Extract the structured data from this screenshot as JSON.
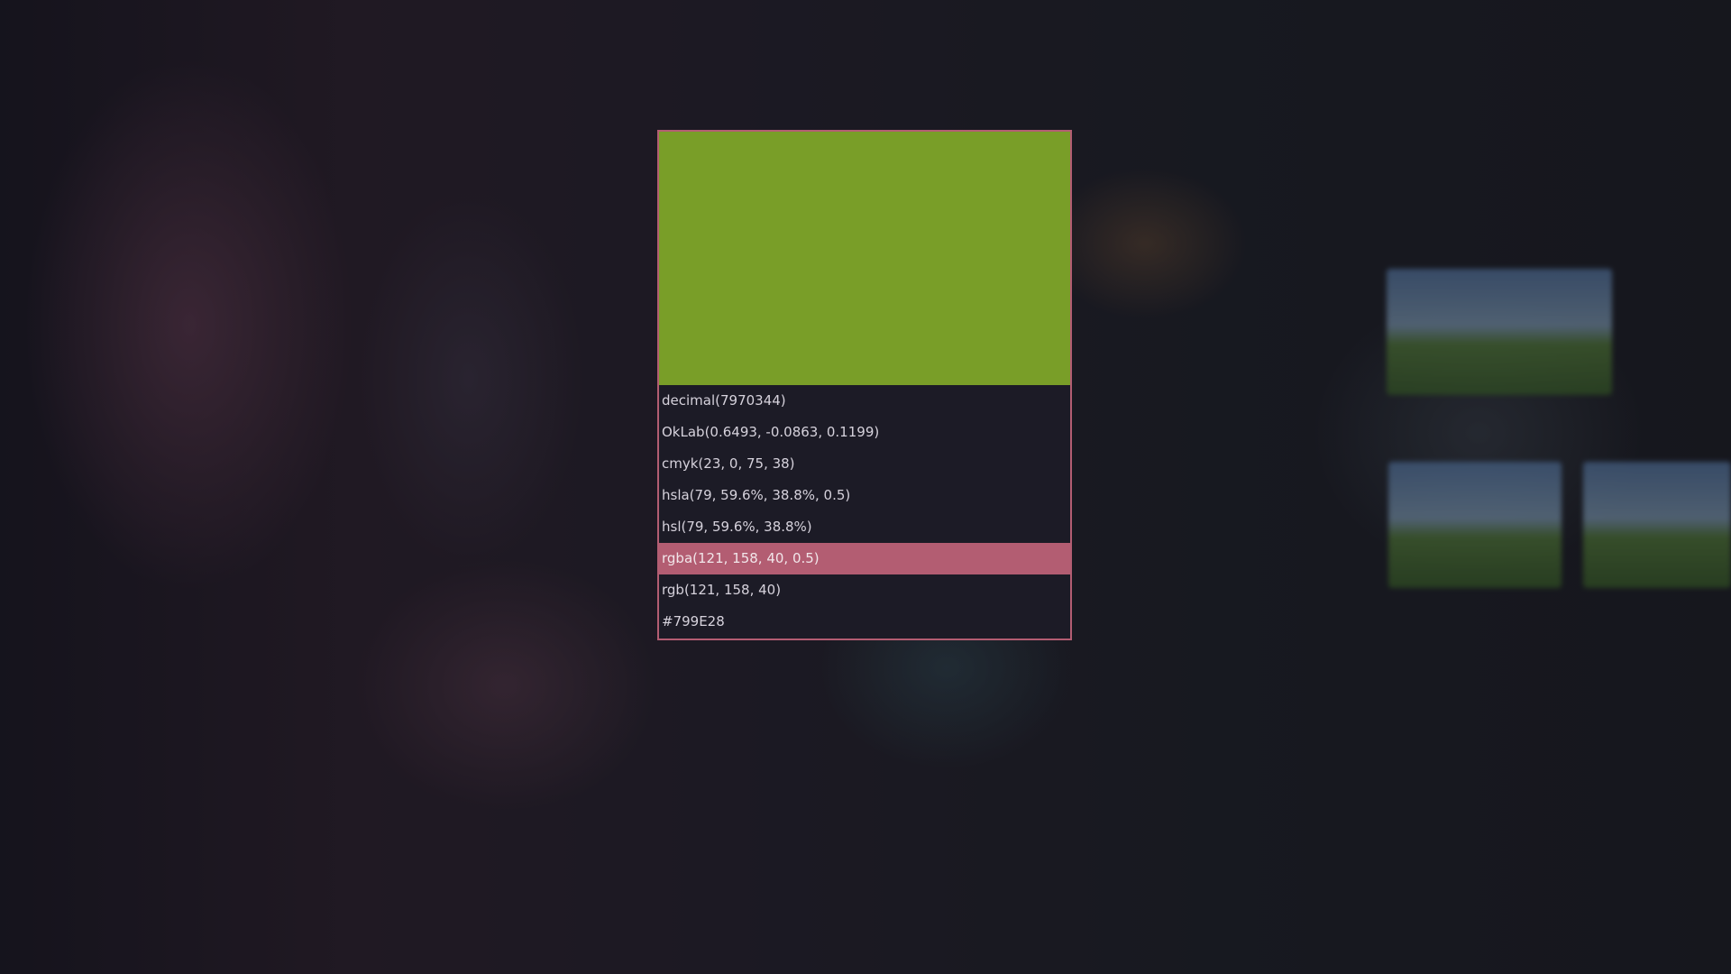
{
  "picker": {
    "swatch_color": "#799E28",
    "selected_index": 5,
    "accent_color": "#b35d72",
    "formats": [
      "decimal(7970344)",
      "OkLab(0.6493, -0.0863, 0.1199)",
      "cmyk(23, 0, 75, 38)",
      "hsla(79, 59.6%, 38.8%, 0.5)",
      "hsl(79, 59.6%, 38.8%)",
      "rgba(121, 158, 40, 0.5)",
      "rgb(121, 158, 40)",
      "#799E28"
    ]
  }
}
